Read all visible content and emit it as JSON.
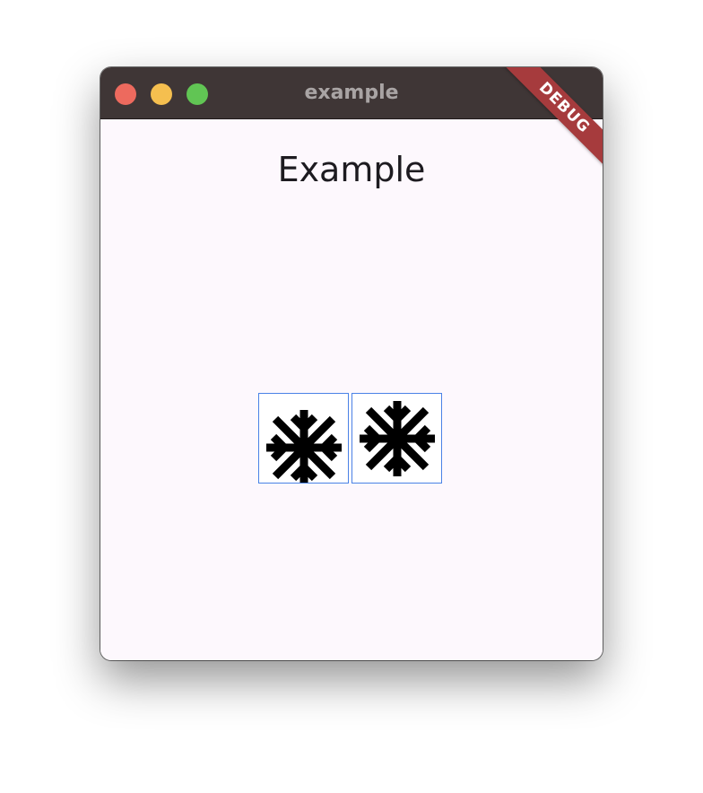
{
  "window": {
    "title": "example",
    "buttons": [
      {
        "name": "close",
        "color": "#ed6a5e"
      },
      {
        "name": "minimize",
        "color": "#f5bf4f"
      },
      {
        "name": "zoom",
        "color": "#61c554"
      }
    ]
  },
  "page": {
    "heading": "Example"
  },
  "debug_banner": {
    "label": "DEBUG",
    "color": "#a63b3d"
  },
  "icons": [
    {
      "name": "snowflake-icon",
      "variant": "asterisk-snowflake"
    },
    {
      "name": "snowflake-icon",
      "variant": "asterisk-snowflake-raised"
    }
  ],
  "colors": {
    "titlebar": "#3f3636",
    "background": "#fdf8fd",
    "icon_border": "#4a82e6",
    "icon_fill": "#000000"
  }
}
